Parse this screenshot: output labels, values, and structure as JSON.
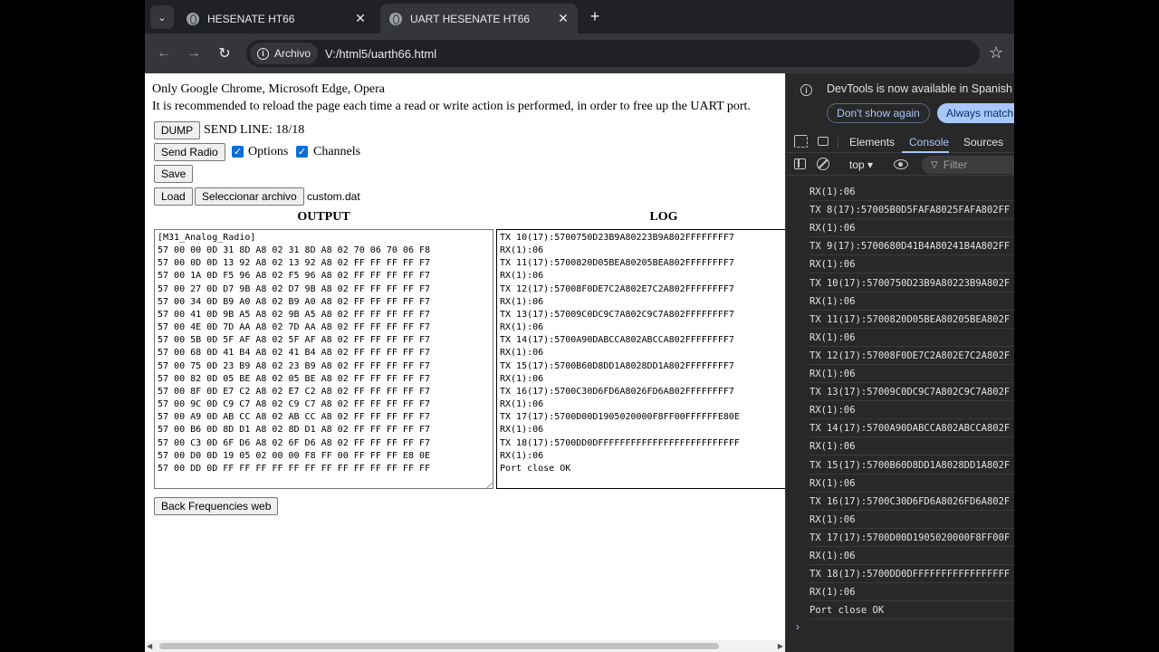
{
  "tabs": [
    {
      "title": "HESENATE HT66",
      "close": "✕"
    },
    {
      "title": "UART HESENATE HT66",
      "close": "✕"
    }
  ],
  "toolbar": {
    "site_chip": "Archivo",
    "url": "V:/html5/uarth66.html"
  },
  "page": {
    "line1": "Only Google Chrome, Microsoft Edge, Opera",
    "line2": "It is recommended to reload the page each time a read or write action is performed, in order to free up the UART port.",
    "dump_label": "DUMP",
    "send_line": "SEND LINE: 18/18",
    "send_radio_label": "Send Radio",
    "options_label": "Options",
    "channels_label": "Channels",
    "save_label": "Save",
    "load_label": "Load",
    "select_file_label": "Seleccionar archivo",
    "file_name": "custom.dat",
    "output_header": "OUTPUT",
    "log_header": "LOG",
    "back_label": "Back Frequencies web",
    "output_text": "[M31_Analog_Radio]\n57 00 00 0D 31 8D A8 02 31 8D A8 02 70 06 70 06 F8\n57 00 0D 0D 13 92 A8 02 13 92 A8 02 FF FF FF FF F7\n57 00 1A 0D F5 96 A8 02 F5 96 A8 02 FF FF FF FF F7\n57 00 27 0D D7 9B A8 02 D7 9B A8 02 FF FF FF FF F7\n57 00 34 0D B9 A0 A8 02 B9 A0 A8 02 FF FF FF FF F7\n57 00 41 0D 9B A5 A8 02 9B A5 A8 02 FF FF FF FF F7\n57 00 4E 0D 7D AA A8 02 7D AA A8 02 FF FF FF FF F7\n57 00 5B 0D 5F AF A8 02 5F AF A8 02 FF FF FF FF F7\n57 00 68 0D 41 B4 A8 02 41 B4 A8 02 FF FF FF FF F7\n57 00 75 0D 23 B9 A8 02 23 B9 A8 02 FF FF FF FF F7\n57 00 82 0D 05 BE A8 02 05 BE A8 02 FF FF FF FF F7\n57 00 8F 0D E7 C2 A8 02 E7 C2 A8 02 FF FF FF FF F7\n57 00 9C 0D C9 C7 A8 02 C9 C7 A8 02 FF FF FF FF F7\n57 00 A9 0D AB CC A8 02 AB CC A8 02 FF FF FF FF F7\n57 00 B6 0D 8D D1 A8 02 8D D1 A8 02 FF FF FF FF F7\n57 00 C3 0D 6F D6 A8 02 6F D6 A8 02 FF FF FF FF F7\n57 00 D0 0D 19 05 02 00 00 F8 FF 00 FF FF FF E8 0E\n57 00 DD 0D FF FF FF FF FF FF FF FF FF FF FF FF FF",
    "log_text": "TX 10(17):5700750D23B9A80223B9A802FFFFFFFF7\nRX(1):06\nTX 11(17):5700820D05BEA80205BEA802FFFFFFFF7\nRX(1):06\nTX 12(17):57008F0DE7C2A802E7C2A802FFFFFFFF7\nRX(1):06\nTX 13(17):57009C0DC9C7A802C9C7A802FFFFFFFF7\nRX(1):06\nTX 14(17):5700A90DABCCA802ABCCA802FFFFFFFF7\nRX(1):06\nTX 15(17):5700B60D8DD1A8028DD1A802FFFFFFFF7\nRX(1):06\nTX 16(17):5700C30D6FD6A8026FD6A802FFFFFFFF7\nRX(1):06\nTX 17(17):5700D00D1905020000F8FF00FFFFFFE80E\nRX(1):06\nTX 18(17):5700DD0DFFFFFFFFFFFFFFFFFFFFFFFFFF\nRX(1):06\nPort close OK"
  },
  "devtools": {
    "banner_text": "DevTools is now available in Spanish",
    "dont_show_label": "Don't show again",
    "always_match_label": "Always match C",
    "tabs": [
      "Elements",
      "Console",
      "Sources"
    ],
    "context": "top ▾",
    "filter_placeholder": "Filter",
    "messages": [
      "RX(1):06",
      "TX 8(17):57005B0D5FAFA8025FAFA802FF",
      "RX(1):06",
      "TX 9(17):5700680D41B4A80241B4A802FF",
      "RX(1):06",
      "TX 10(17):5700750D23B9A80223B9A802F",
      "RX(1):06",
      "TX 11(17):5700820D05BEA80205BEA802F",
      "RX(1):06",
      "TX 12(17):57008F0DE7C2A802E7C2A802F",
      "RX(1):06",
      "TX 13(17):57009C0DC9C7A802C9C7A802F",
      "RX(1):06",
      "TX 14(17):5700A90DABCCA802ABCCA802F",
      "RX(1):06",
      "TX 15(17):5700B60D8DD1A8028DD1A802F",
      "RX(1):06",
      "TX 16(17):5700C30D6FD6A8026FD6A802F",
      "RX(1):06",
      "TX 17(17):5700D00D1905020000F8FF00F",
      "RX(1):06",
      "TX 18(17):5700DD0DFFFFFFFFFFFFFFFFF",
      "RX(1):06",
      "Port close OK"
    ]
  }
}
